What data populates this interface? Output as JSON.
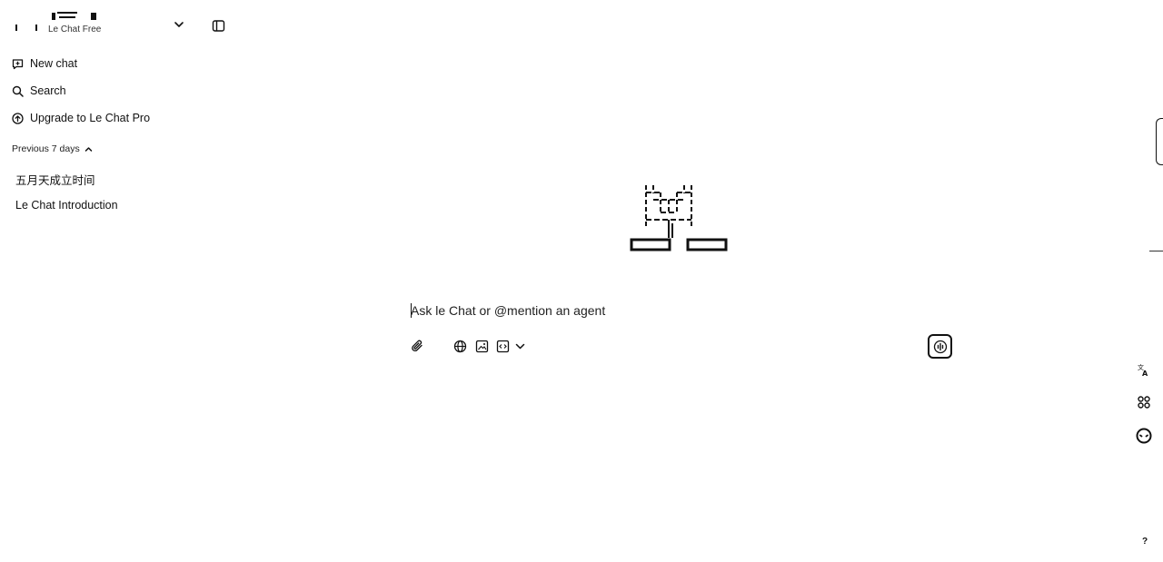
{
  "workspace": {
    "plan": "Le Chat Free"
  },
  "nav": {
    "new_chat": "New chat",
    "search": "Search",
    "upgrade": "Upgrade to Le Chat Pro"
  },
  "history": {
    "section_label": "Previous 7 days",
    "items": [
      {
        "title": "五月天成立时间"
      },
      {
        "title": "Le Chat Introduction"
      }
    ]
  },
  "composer": {
    "placeholder": "Ask le Chat or @mention an agent",
    "value": ""
  },
  "tools": [
    "paperclip-icon",
    "globe-icon",
    "image-icon",
    "code-canvas-icon",
    "chevron-down-icon"
  ],
  "right_rail": [
    "translate-icon",
    "apps-icon",
    "face-icon",
    "help-icon"
  ],
  "help": {
    "label": "?"
  },
  "colors": {
    "foreground": "#111111",
    "background": "#ffffff"
  }
}
